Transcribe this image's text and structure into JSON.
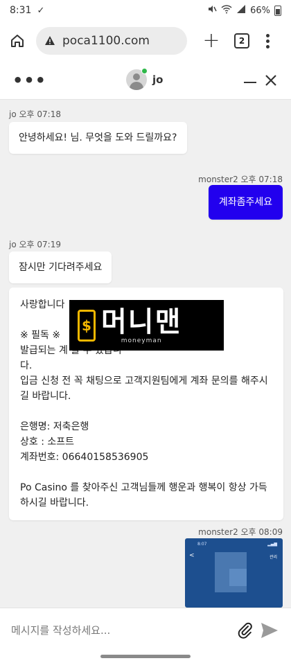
{
  "status_bar": {
    "time": "8:31",
    "battery": "66%",
    "icons": [
      "check-icon",
      "mute-icon",
      "wifi-icon",
      "signal-icon",
      "battery-icon"
    ]
  },
  "browser": {
    "url": "poca1100.com",
    "tab_count": "2",
    "icons": [
      "home-icon",
      "warning-icon",
      "plus-icon",
      "tabs-icon",
      "more-vertical-icon"
    ]
  },
  "chat_header": {
    "agent_name": "jo",
    "agent_status_color": "#2fb84a",
    "icons": [
      "more-horizontal-icon",
      "avatar-icon",
      "minimize-icon",
      "close-icon"
    ]
  },
  "messages": [
    {
      "sender": "jo",
      "time": "오후 07:18",
      "meta": "jo 오후 07:18",
      "text": "안녕하세요! 님. 무엇을 도와 드릴까요?",
      "side": "left"
    },
    {
      "sender": "monster2",
      "time": "오후 07:18",
      "meta": "monster2 오후 07:18",
      "text": "계좌좀주세요",
      "side": "right"
    },
    {
      "sender": "jo",
      "time": "오후 07:19",
      "meta": "jo 오후 07:19",
      "text": "잠시만 기다려주세요",
      "side": "left"
    },
    {
      "sender": "jo",
      "side": "left",
      "lines": [
        "사랑합니다 ",
        "",
        "※ 필독 ※",
        "발급되는 계                  을 수 있습니",
        "다.",
        "입금 신청 전 꼭 채팅으로 고객지원팀에게 계좌 문의를 해주시",
        "길 바랍니다.",
        "",
        "은행명: 저축은행",
        "상호 : 소프트",
        "계좌번호: 06640158536905",
        "",
        "Po Casino 를 찾아주신 고객님들께 행운과 행복이 항상 가득",
        "하시길 바랍니다."
      ]
    },
    {
      "sender": "monster2",
      "time": "오후 08:09",
      "meta": "monster2 오후 08:09",
      "type": "image",
      "side": "right"
    }
  ],
  "watermark": {
    "logo_text": "머니맨",
    "logo_symbol": "$",
    "logo_sub": "moneyman",
    "accent_color": "#f5b800"
  },
  "attachment_thumbnail": {
    "time": "8:07",
    "right_label": "관리",
    "back_glyph": "<"
  },
  "input": {
    "placeholder": "메시지를 작성하세요...",
    "icons": [
      "paperclip-icon",
      "send-icon"
    ]
  },
  "colors": {
    "my_bubble": "#2200ee",
    "chat_background": "#f0f0f0"
  }
}
